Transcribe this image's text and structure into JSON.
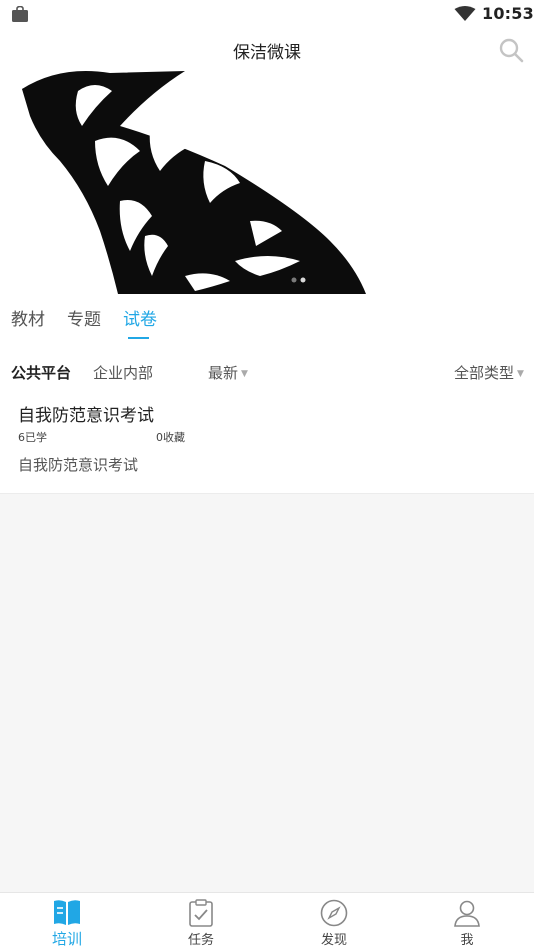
{
  "status_bar": {
    "time": "10:53",
    "left_icon": "shopping-bag-icon",
    "right_icon": "wifi-icon"
  },
  "header": {
    "title": "保洁微课",
    "search_icon": "search-icon"
  },
  "banner": {
    "image": "black-and-white dog illustration",
    "page_count": 2,
    "active_page": 2
  },
  "tabs": [
    {
      "label": "教材",
      "active": false
    },
    {
      "label": "专题",
      "active": false
    },
    {
      "label": "试卷",
      "active": true
    }
  ],
  "filters": {
    "scope": [
      {
        "label": "公共平台",
        "selected": true
      },
      {
        "label": "企业内部",
        "selected": false
      }
    ],
    "sort": {
      "label": "最新",
      "caret": "▼"
    },
    "type": {
      "label": "全部类型",
      "caret": "▼"
    }
  },
  "exam_list": [
    {
      "title": "自我防范意识考试",
      "learned": "6已学",
      "favorites": "0收藏",
      "description": "自我防范意识考试"
    }
  ],
  "bottom_nav": [
    {
      "label": "培训",
      "icon": "book-icon",
      "active": true
    },
    {
      "label": "任务",
      "icon": "clipboard-icon",
      "active": false
    },
    {
      "label": "发现",
      "icon": "compass-icon",
      "active": false
    },
    {
      "label": "我",
      "icon": "user-icon",
      "active": false
    }
  ],
  "colors": {
    "accent": "#21a7e5",
    "background": "#f6f6f6",
    "surface": "#ffffff"
  }
}
